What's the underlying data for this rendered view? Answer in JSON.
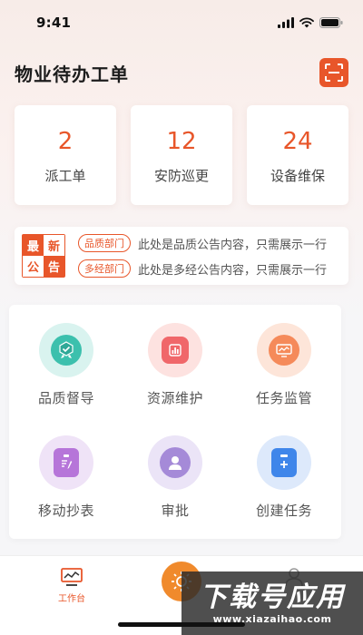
{
  "status_bar": {
    "time": "9:41"
  },
  "header": {
    "title": "物业待办工单"
  },
  "stats": [
    {
      "value": "2",
      "label": "派工单"
    },
    {
      "value": "12",
      "label": "安防巡更"
    },
    {
      "value": "24",
      "label": "设备维保"
    }
  ],
  "notice": {
    "badge": [
      "最",
      "新",
      "公",
      "告"
    ],
    "items": [
      {
        "dept": "品质部门",
        "text": "此处是品质公告内容，只需展示一行"
      },
      {
        "dept": "多经部门",
        "text": "此处是多经公告内容，只需展示一行"
      }
    ]
  },
  "grid": [
    {
      "label": "品质督导",
      "icon": "badge-check-icon"
    },
    {
      "label": "资源维护",
      "icon": "bar-chart-icon"
    },
    {
      "label": "任务监管",
      "icon": "monitor-icon"
    },
    {
      "label": "移动抄表",
      "icon": "clipboard-pen-icon"
    },
    {
      "label": "审批",
      "icon": "person-icon"
    },
    {
      "label": "创建任务",
      "icon": "add-file-icon"
    }
  ],
  "tabbar": {
    "items": [
      {
        "label": "工作台",
        "icon": "chart-monitor-icon",
        "active": true
      },
      {
        "label": "",
        "icon": "sun-icon",
        "active": false
      },
      {
        "label": "",
        "icon": "person-icon",
        "active": false
      }
    ]
  },
  "watermark": {
    "title": "下载号应用",
    "url": "www.xiazaihao.com"
  },
  "colors": {
    "accent": "#e8562a",
    "text": "#222222",
    "muted": "#555555",
    "background": "#f6f6f8"
  }
}
